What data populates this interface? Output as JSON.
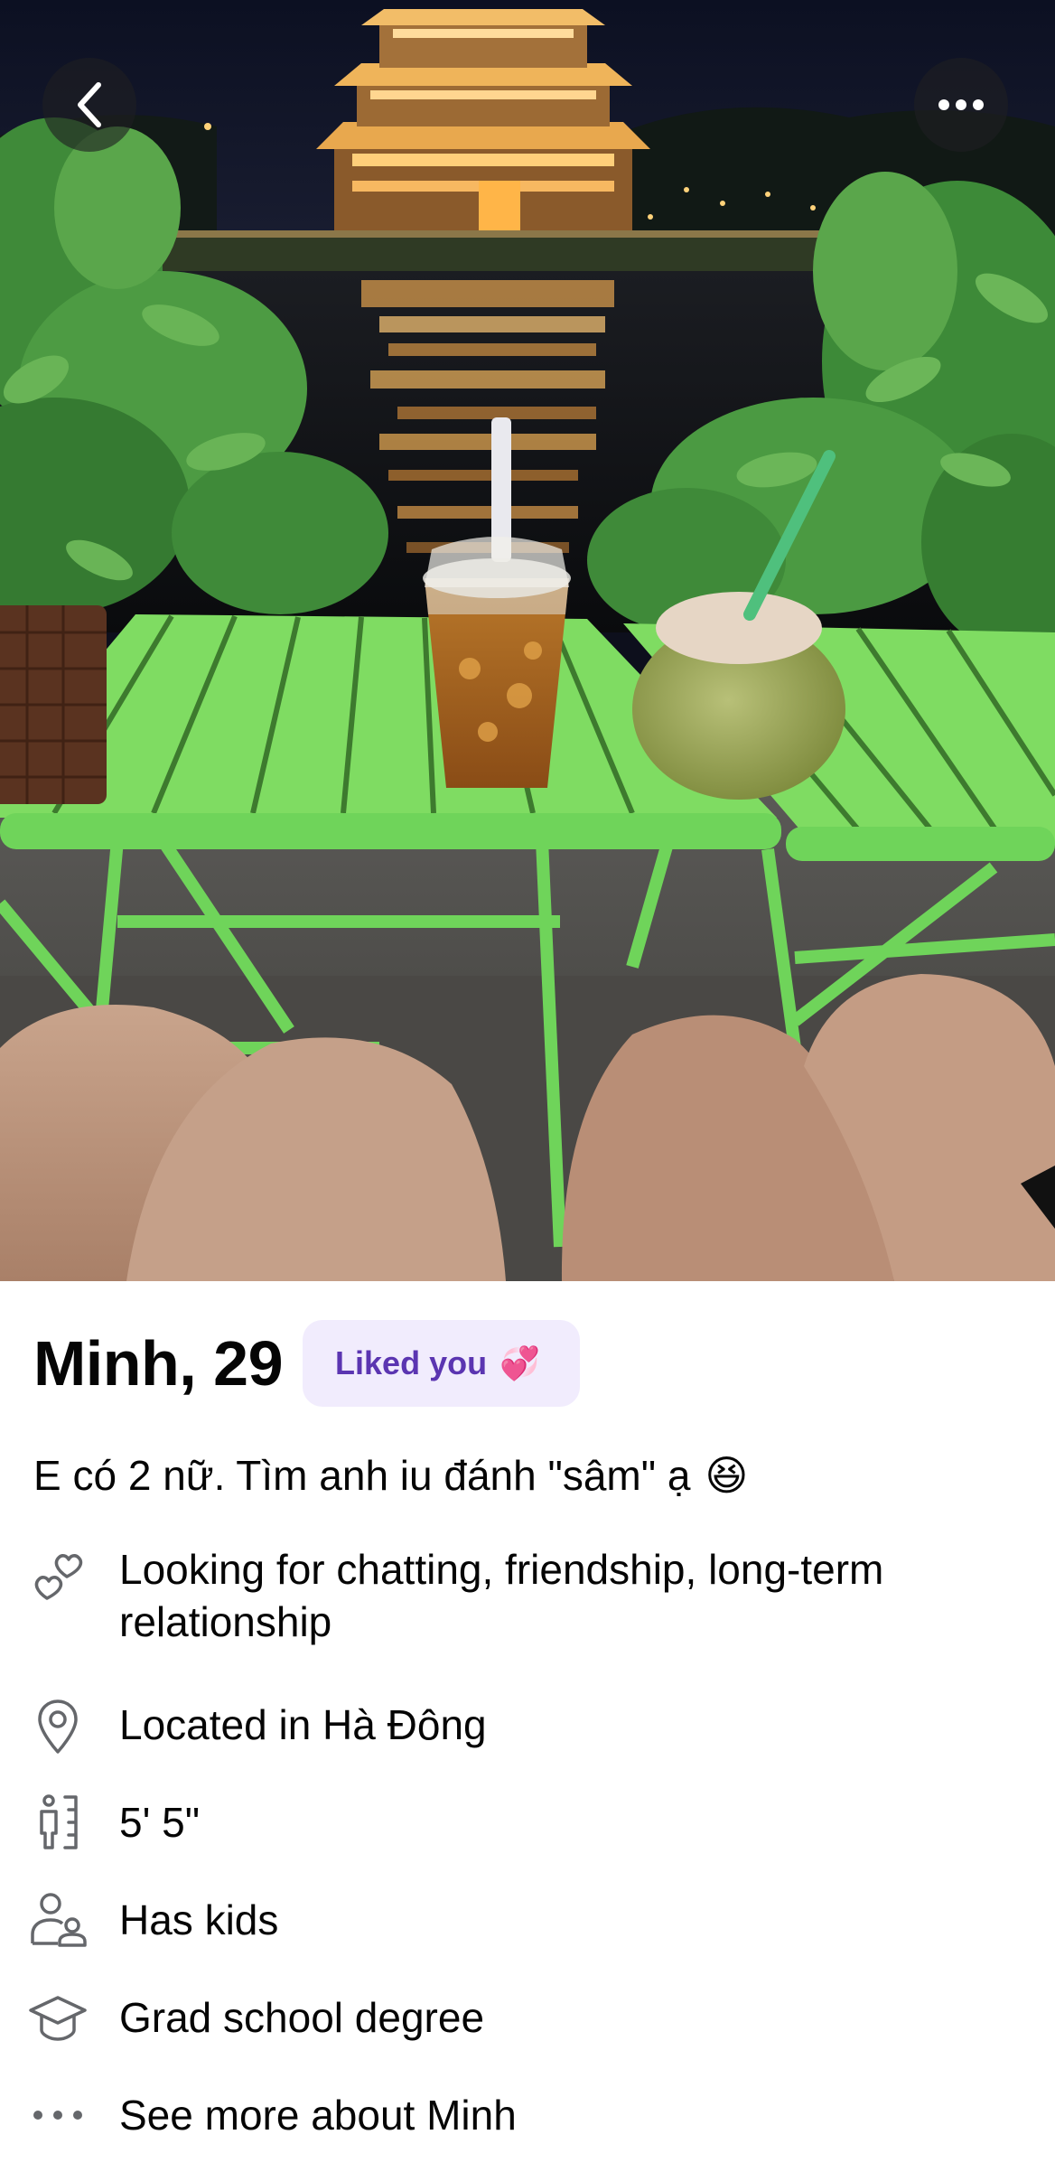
{
  "nav": {
    "back_icon": "chevron-left-icon",
    "more_icon": "ellipsis-icon"
  },
  "profile": {
    "name_age": "Minh, 29",
    "badge_label": "Liked you",
    "badge_emoji": "💞",
    "bio_text": "E có 2 nữ. Tìm anh iu đánh \"sâm\" ạ",
    "bio_emoji": "😆"
  },
  "details": [
    {
      "icon": "hearts-icon",
      "text": "Looking for chatting, friendship, long-term relationship"
    },
    {
      "icon": "location-pin-icon",
      "text": "Located in Hà Đông"
    },
    {
      "icon": "height-icon",
      "text": "5' 5\""
    },
    {
      "icon": "parent-child-icon",
      "text": "Has kids"
    },
    {
      "icon": "graduation-cap-icon",
      "text": "Grad school degree"
    },
    {
      "icon": "ellipsis-icon",
      "text": "See more about Minh"
    }
  ],
  "colors": {
    "badge_bg": "#f1ecfd",
    "badge_text": "#5b35b1",
    "text": "#050505",
    "icon": "#65676b"
  }
}
